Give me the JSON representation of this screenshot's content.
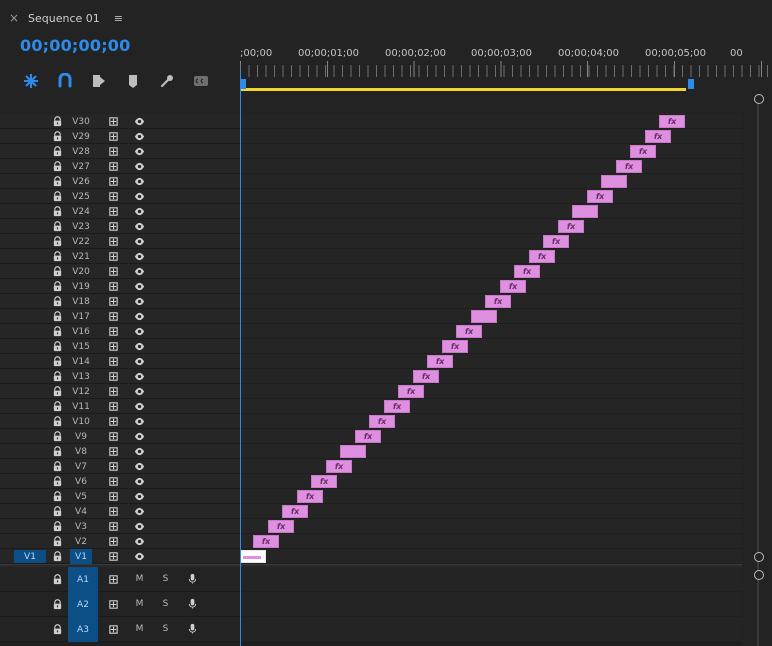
{
  "panel": {
    "title": "Sequence 01",
    "close_symbol": "×",
    "menu_symbol": "≡"
  },
  "timecode": "00;00;00;00",
  "ruler_labels": [
    ";00;00",
    "00;00;01;00",
    "00;00;02;00",
    "00;00;03;00",
    "00;00;04;00",
    "00;00;05;00",
    "00"
  ],
  "video_tracks": [
    "V30",
    "V29",
    "V28",
    "V27",
    "V26",
    "V25",
    "V24",
    "V23",
    "V22",
    "V21",
    "V20",
    "V19",
    "V18",
    "V17",
    "V16",
    "V15",
    "V14",
    "V13",
    "V12",
    "V11",
    "V10",
    "V9",
    "V8",
    "V7",
    "V6",
    "V5",
    "V4",
    "V3",
    "V2",
    "V1"
  ],
  "v1_source_patch": "V1",
  "clips_fx": "fx",
  "audio_tracks": [
    "A1",
    "A2",
    "A3"
  ],
  "audio_controls": {
    "mute": "M",
    "solo": "S"
  }
}
